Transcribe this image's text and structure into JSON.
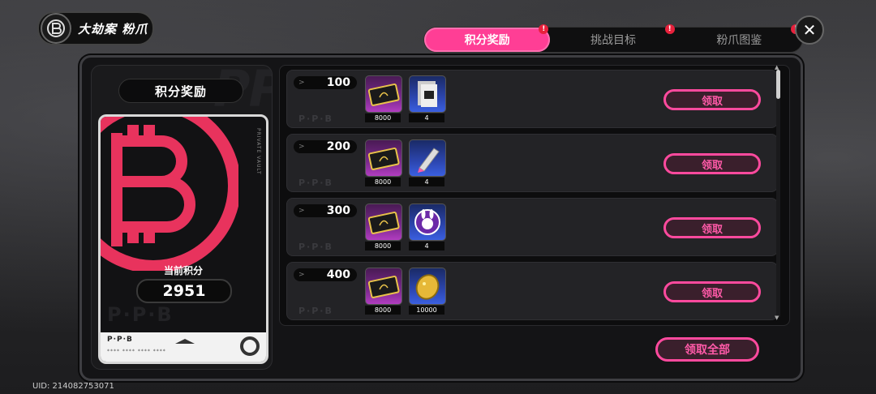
{
  "event": {
    "title": "大劫案  粉爪",
    "logo_icon": "ppb-coin-icon"
  },
  "tabs": [
    {
      "label": "积分奖励",
      "active": true,
      "alert": "!"
    },
    {
      "label": "挑战目标",
      "active": false,
      "alert": "!"
    },
    {
      "label": "粉爪图鉴",
      "active": false,
      "alert": "!"
    }
  ],
  "close_icon": "close-icon",
  "left_panel": {
    "title": "积分奖励",
    "watermark": "PPB",
    "card": {
      "score_label": "当前积分",
      "score_value": "2951",
      "brand_faint": "P·P·B",
      "foot_brand": "P·P·B",
      "foot_number": "**** **** **** ****"
    }
  },
  "rewards": [
    {
      "tier": "100",
      "items": [
        {
          "qty": "8000",
          "kind": "purple",
          "icon": "gold-card-icon"
        },
        {
          "qty": "4",
          "kind": "blue",
          "icon": "ticket-stack-icon"
        }
      ],
      "claim_label": "领取"
    },
    {
      "tier": "200",
      "items": [
        {
          "qty": "8000",
          "kind": "purple",
          "icon": "gold-card-icon"
        },
        {
          "qty": "4",
          "kind": "blue",
          "icon": "tube-icon"
        }
      ],
      "claim_label": "领取"
    },
    {
      "tier": "300",
      "items": [
        {
          "qty": "8000",
          "kind": "purple",
          "icon": "gold-card-icon"
        },
        {
          "qty": "4",
          "kind": "blue",
          "icon": "bunny-badge-icon"
        }
      ],
      "claim_label": "领取"
    },
    {
      "tier": "400",
      "items": [
        {
          "qty": "8000",
          "kind": "purple",
          "icon": "gold-card-icon"
        },
        {
          "qty": "10000",
          "kind": "blue",
          "icon": "gold-nugget-icon"
        }
      ],
      "claim_label": "领取"
    }
  ],
  "row_brand": "P·P·B",
  "claim_all_label": "领取全部",
  "uid": "UID: 214082753071",
  "colors": {
    "accent": "#ff3e95",
    "panel": "#141416",
    "claim_border": "#ff4a9e"
  }
}
